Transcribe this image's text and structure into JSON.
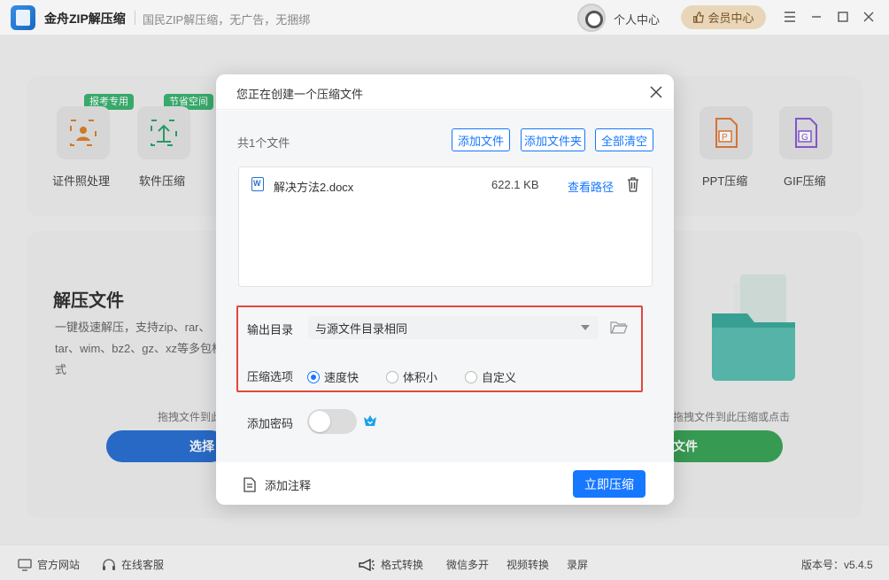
{
  "window": {
    "app_name": "金舟ZIP解压缩",
    "slogan": "国民ZIP解压缩，无广告，无捆绑",
    "personal_center": "个人中心",
    "vip_center": "会员中心",
    "controls": [
      "menu-icon",
      "minimize-icon",
      "maximize-icon",
      "close-icon"
    ]
  },
  "background": {
    "tools": [
      {
        "label": "证件照处理",
        "tag": "报考专用",
        "icon": "id-photo-icon"
      },
      {
        "label": "软件压缩",
        "tag": "节省空间",
        "icon": "software-compress-icon"
      },
      {
        "label": "PPT压缩",
        "icon": "ppt-icon"
      },
      {
        "label": "GIF压缩",
        "icon": "gif-icon"
      }
    ],
    "decompress_title": "解压文件",
    "decompress_desc": "一键极速解压，支持zip、rar、tar、wim、bz2、gz、xz等多包格式",
    "hint_left": "拖拽文件到此",
    "hint_right": "拖拽文件到此压缩或点击",
    "btn_left": "选择",
    "btn_right": "文件"
  },
  "dialog": {
    "title": "您正在创建一个压缩文件",
    "file_count": "共1个文件",
    "add_file": "添加文件",
    "add_folder": "添加文件夹",
    "clear_all": "全部清空",
    "files": [
      {
        "name": "解决方法2.docx",
        "size": "622.1 KB",
        "action": "查看路径"
      }
    ],
    "output_dir_label": "输出目录",
    "output_dir_value": "与源文件目录相同",
    "compress_option_label": "压缩选项",
    "options": [
      {
        "label": "速度快",
        "selected": true
      },
      {
        "label": "体积小",
        "selected": false
      },
      {
        "label": "自定义",
        "selected": false
      }
    ],
    "password_label": "添加密码",
    "password_enabled": false,
    "add_note": "添加注释",
    "compress_now": "立即压缩"
  },
  "statusbar": {
    "official_site": "官方网站",
    "online_support": "在线客服",
    "format_convert": "格式转换",
    "wechat_multi": "微信多开",
    "video_convert": "视频转换",
    "screen_record": "录屏",
    "version": "版本号：v5.4.5"
  },
  "colors": {
    "accent": "#1677ff",
    "highlight_border": "#e0483c",
    "vip_bg": "#e9d6b9"
  }
}
